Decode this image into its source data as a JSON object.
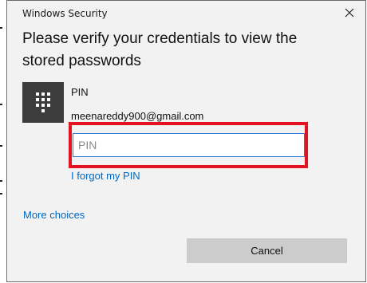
{
  "dialog": {
    "title": "Windows Security",
    "heading": "Please verify your credentials to view the stored passwords",
    "credential": {
      "icon": "keypad-icon",
      "label": "PIN",
      "username": "meenareddy900@gmail.com",
      "input_placeholder": "PIN",
      "input_value": ""
    },
    "forgot_link": "I forgot my PIN",
    "more_choices": "More choices",
    "cancel_label": "Cancel"
  },
  "colors": {
    "dialog_bg": "#f2f2f2",
    "link": "#0067c0",
    "highlight": "#e3131f",
    "input_border": "#2b7bd6",
    "cancel_bg": "#cccccc",
    "tile_bg": "#3c3c3c"
  }
}
